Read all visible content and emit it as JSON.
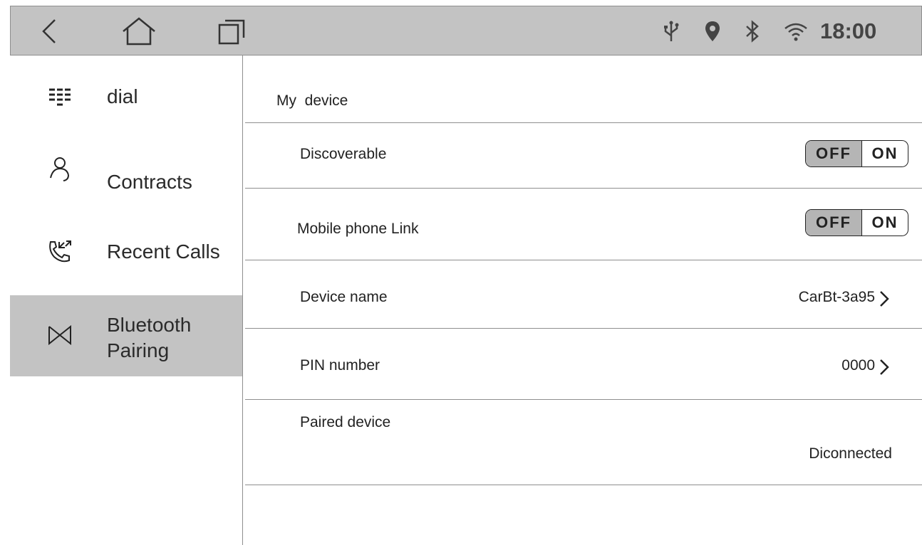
{
  "status_bar": {
    "time": "18:00",
    "nav_icons": [
      "back-icon",
      "home-icon",
      "recent-apps-icon"
    ],
    "status_icons": [
      "usb-icon",
      "location-icon",
      "bluetooth-icon",
      "wifi-icon"
    ],
    "background": "#c3c3c3"
  },
  "sidebar": {
    "items": [
      {
        "label": "dial",
        "icon": "dialpad-icon",
        "selected": false
      },
      {
        "label": "Contracts",
        "icon": "contact-icon",
        "selected": false
      },
      {
        "label": "Recent Calls",
        "icon": "call-log-icon",
        "selected": false
      },
      {
        "label_line1": "Bluetooth",
        "label_line2": "Pairing",
        "icon": "bluetooth-pairing-icon",
        "selected": true
      }
    ],
    "selected_color": "#c3c3c3"
  },
  "main": {
    "section_title": "My  device",
    "rows": {
      "discoverable": {
        "label": "Discoverable",
        "off": "OFF",
        "on": "ON",
        "state": "OFF"
      },
      "mobile_link": {
        "label": "Mobile phone Link",
        "off": "OFF",
        "on": "ON",
        "state": "OFF"
      },
      "device_name": {
        "label": "Device name",
        "value": "CarBt-3a95"
      },
      "pin": {
        "label": "PIN number",
        "value": "0000"
      },
      "paired": {
        "label": "Paired device",
        "value": "Diconnected"
      }
    }
  }
}
